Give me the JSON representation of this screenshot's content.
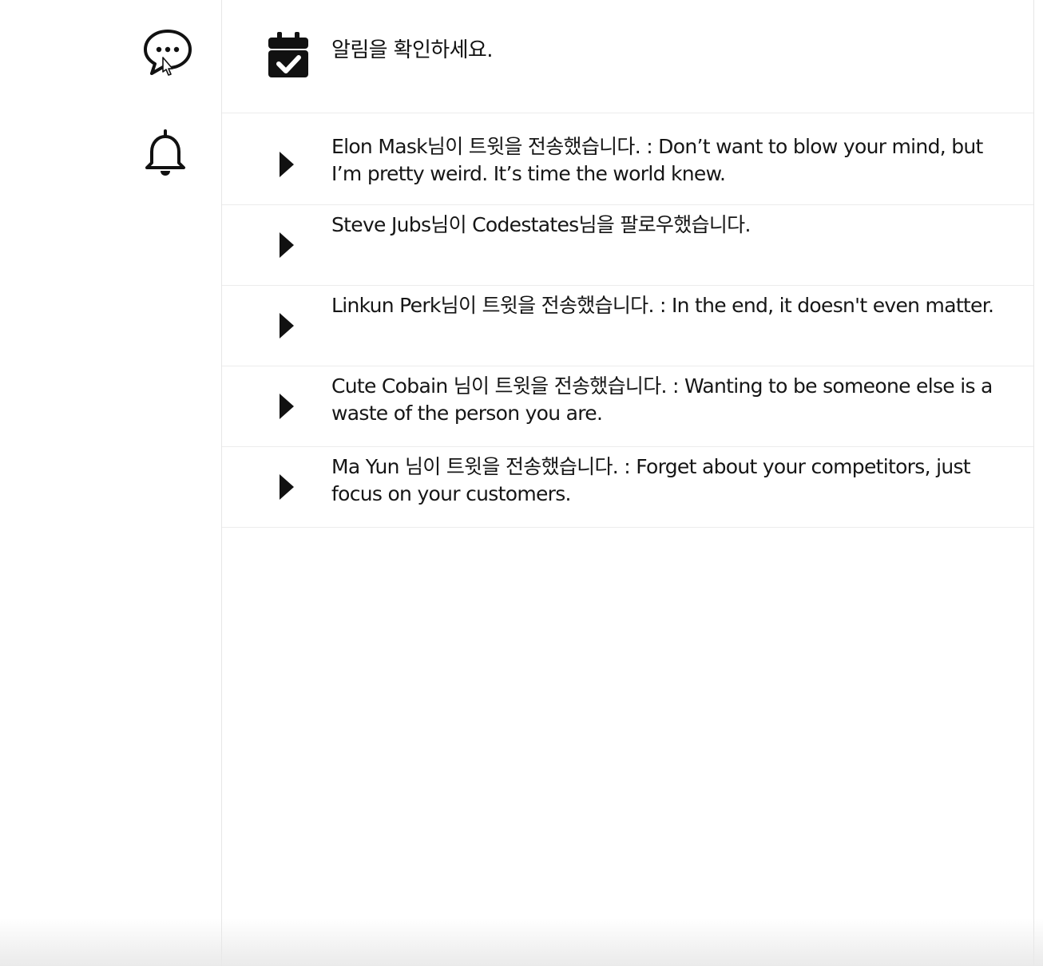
{
  "sidebar": {
    "icons": [
      {
        "name": "message-icon",
        "label": ""
      },
      {
        "name": "bell-icon",
        "label": ""
      }
    ]
  },
  "header": {
    "icon": "calendar-check-icon",
    "title": "알림을 확인하세요."
  },
  "notifications": [
    {
      "icon": "play-arrow-icon",
      "text": "Elon Mask님이 트윗을 전송했습니다. : Don’t want to blow your mind, but I’m pretty weird. It’s time the world knew."
    },
    {
      "icon": "play-arrow-icon",
      "text": "Steve Jubs님이 Codestates님을 팔로우했습니다."
    },
    {
      "icon": "play-arrow-icon",
      "text": "Linkun Perk님이 트윗을 전송했습니다. : In the end, it doesn't even matter."
    },
    {
      "icon": "play-arrow-icon",
      "text": "Cute Cobain 님이 트윗을 전송했습니다. : Wanting to be someone else is a waste of the person you are."
    },
    {
      "icon": "play-arrow-icon",
      "text": "Ma Yun 님이 트윗을 전송했습니다. : Forget about your competitors, just focus on your customers."
    }
  ],
  "colors": {
    "icon": "#111111",
    "border": "#ececec",
    "background": "#ffffff"
  }
}
